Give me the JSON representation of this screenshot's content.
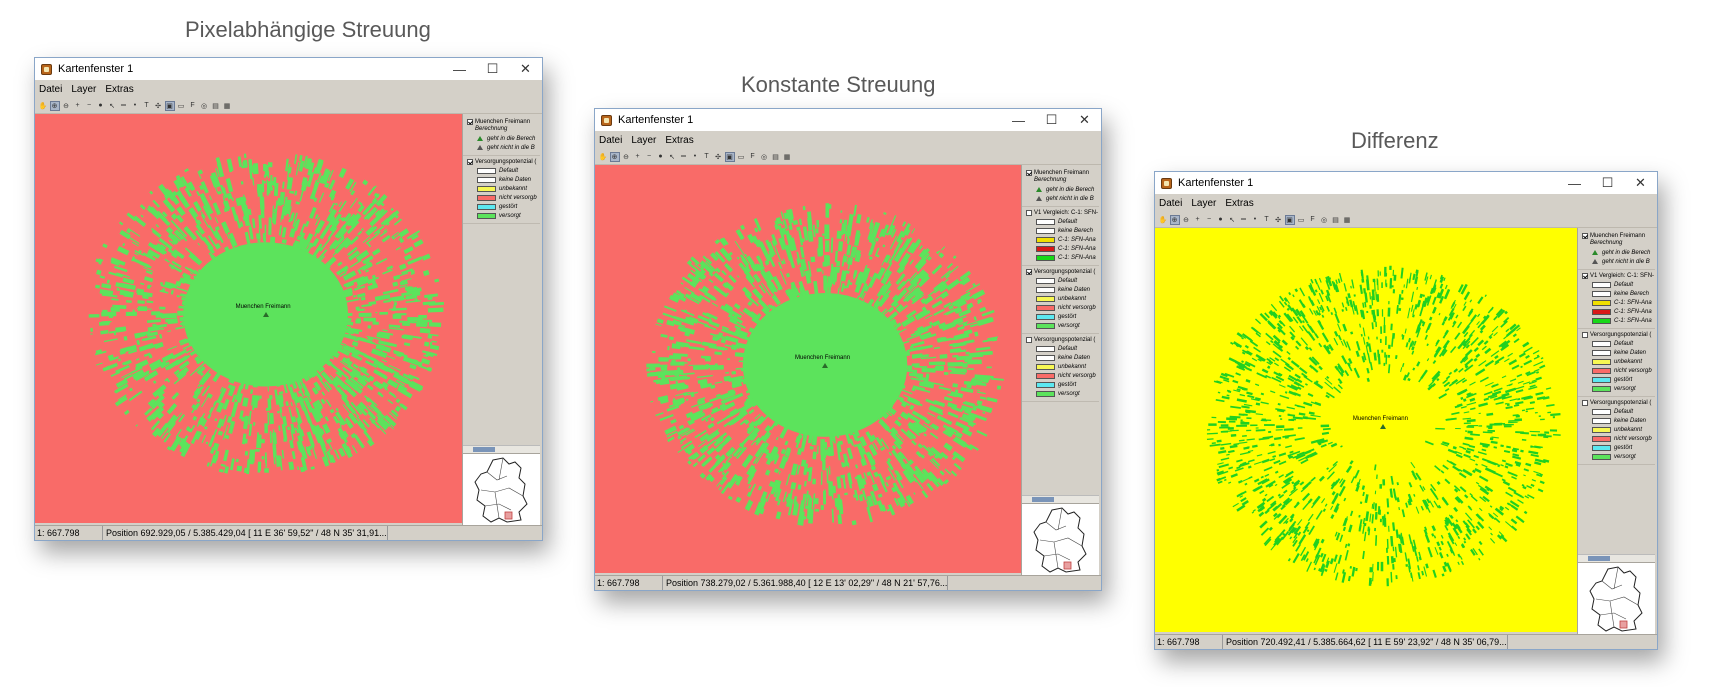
{
  "panels": [
    {
      "heading": "Pixelabhängige Streuung",
      "window": {
        "title": "Kartenfenster 1",
        "menu": [
          "Datei",
          "Layer",
          "Extras"
        ],
        "map": {
          "background": "#f96b68",
          "coverage_color": "#5ce35c",
          "site_label": "Muenchen Freimann"
        },
        "legend": [
          {
            "name": "Muenchen Freimann",
            "checked": true,
            "sublabel": "Berechnung",
            "items": [
              {
                "type": "tri-filled",
                "label": "geht in die Berech"
              },
              {
                "type": "tri-hollow",
                "label": "geht nicht in die B"
              }
            ]
          },
          {
            "name": "Versorgungspotenzial (",
            "checked": true,
            "sublabel": "",
            "items": [
              {
                "type": "swatch",
                "color": "#ffffff",
                "label": "Default"
              },
              {
                "type": "swatch",
                "color": "#ffffff",
                "label": "keine Daten"
              },
              {
                "type": "swatch",
                "color": "#f7f752",
                "label": "unbekannt"
              },
              {
                "type": "swatch",
                "color": "#f96b68",
                "label": "nicht versorgb"
              },
              {
                "type": "swatch",
                "color": "#5ce8f0",
                "label": "gestört"
              },
              {
                "type": "swatch",
                "color": "#5ce35c",
                "label": "versorgt"
              }
            ]
          }
        ],
        "status": {
          "scale": "1: 667.798",
          "position": "Position 692.929,05 / 5.385.429,04 [  11 E 36' 59,52\"  / 48 N 35' 31,91..."
        }
      }
    },
    {
      "heading": "Konstante Streuung",
      "window": {
        "title": "Kartenfenster 1",
        "menu": [
          "Datei",
          "Layer",
          "Extras"
        ],
        "map": {
          "background": "#f96b68",
          "coverage_color": "#5ce35c",
          "site_label": "Muenchen Freimann"
        },
        "legend": [
          {
            "name": "Muenchen Freimann",
            "checked": true,
            "sublabel": "Berechnung",
            "items": [
              {
                "type": "tri-filled",
                "label": "geht in die Berech"
              },
              {
                "type": "tri-hollow",
                "label": "geht nicht in die B"
              }
            ]
          },
          {
            "name": "V1 Vergleich: C-1: SFN-",
            "checked": false,
            "sublabel": "",
            "items": [
              {
                "type": "swatch",
                "color": "#ffffff",
                "label": "Default"
              },
              {
                "type": "swatch",
                "color": "#ffffff",
                "label": "keine Berech"
              },
              {
                "type": "swatch",
                "color": "#f0e000",
                "label": "C-1: SFN-Ana"
              },
              {
                "type": "swatch",
                "color": "#d81818",
                "label": "C-1: SFN-Ana"
              },
              {
                "type": "swatch",
                "color": "#18d818",
                "label": "C-1: SFN-Ana"
              }
            ]
          },
          {
            "name": "Versorgungspotenzial (",
            "checked": true,
            "sublabel": "",
            "items": [
              {
                "type": "swatch",
                "color": "#ffffff",
                "label": "Default"
              },
              {
                "type": "swatch",
                "color": "#ffffff",
                "label": "keine Daten"
              },
              {
                "type": "swatch",
                "color": "#f7f752",
                "label": "unbekannt"
              },
              {
                "type": "swatch",
                "color": "#f96b68",
                "label": "nicht versorgb"
              },
              {
                "type": "swatch",
                "color": "#5ce8f0",
                "label": "gestört"
              },
              {
                "type": "swatch",
                "color": "#5ce35c",
                "label": "versorgt"
              }
            ]
          },
          {
            "name": "Versorgungspotenzial (",
            "checked": false,
            "sublabel": "",
            "items": [
              {
                "type": "swatch",
                "color": "#ffffff",
                "label": "Default"
              },
              {
                "type": "swatch",
                "color": "#ffffff",
                "label": "keine Daten"
              },
              {
                "type": "swatch",
                "color": "#f7f752",
                "label": "unbekannt"
              },
              {
                "type": "swatch",
                "color": "#f96b68",
                "label": "nicht versorgb"
              },
              {
                "type": "swatch",
                "color": "#5ce8f0",
                "label": "gestört"
              },
              {
                "type": "swatch",
                "color": "#5ce35c",
                "label": "versorgt"
              }
            ]
          }
        ],
        "status": {
          "scale": "1: 667.798",
          "position": "Position 738.279,02 / 5.361.988,40 [  12 E 13' 02,29\"  / 48 N 21' 57,76..."
        }
      }
    },
    {
      "heading": "Differenz",
      "window": {
        "title": "Kartenfenster 1",
        "menu": [
          "Datei",
          "Layer",
          "Extras"
        ],
        "map": {
          "background": "#ffff00",
          "coverage_color": "#20d020",
          "site_label": "Muenchen Freimann"
        },
        "legend": [
          {
            "name": "Muenchen Freimann",
            "checked": true,
            "sublabel": "Berechnung",
            "items": [
              {
                "type": "tri-filled",
                "label": "geht in die Berech"
              },
              {
                "type": "tri-hollow",
                "label": "geht nicht in die B"
              }
            ]
          },
          {
            "name": "V1 Vergleich: C-1: SFN-",
            "checked": true,
            "sublabel": "",
            "items": [
              {
                "type": "swatch",
                "color": "#ffffff",
                "label": "Default"
              },
              {
                "type": "swatch",
                "color": "#ffffff",
                "label": "keine Berech"
              },
              {
                "type": "swatch",
                "color": "#f0e000",
                "label": "C-1: SFN-Ana"
              },
              {
                "type": "swatch",
                "color": "#d81818",
                "label": "C-1: SFN-Ana"
              },
              {
                "type": "swatch",
                "color": "#18d818",
                "label": "C-1: SFN-Ana"
              }
            ]
          },
          {
            "name": "Versorgungspotenzial (",
            "checked": false,
            "sublabel": "",
            "items": [
              {
                "type": "swatch",
                "color": "#ffffff",
                "label": "Default"
              },
              {
                "type": "swatch",
                "color": "#ffffff",
                "label": "keine Daten"
              },
              {
                "type": "swatch",
                "color": "#f7f752",
                "label": "unbekannt"
              },
              {
                "type": "swatch",
                "color": "#f96b68",
                "label": "nicht versorgb"
              },
              {
                "type": "swatch",
                "color": "#5ce8f0",
                "label": "gestört"
              },
              {
                "type": "swatch",
                "color": "#5ce35c",
                "label": "versorgt"
              }
            ]
          },
          {
            "name": "Versorgungspotenzial (",
            "checked": false,
            "sublabel": "",
            "items": [
              {
                "type": "swatch",
                "color": "#ffffff",
                "label": "Default"
              },
              {
                "type": "swatch",
                "color": "#ffffff",
                "label": "keine Daten"
              },
              {
                "type": "swatch",
                "color": "#f7f752",
                "label": "unbekannt"
              },
              {
                "type": "swatch",
                "color": "#f96b68",
                "label": "nicht versorgb"
              },
              {
                "type": "swatch",
                "color": "#5ce8f0",
                "label": "gestört"
              },
              {
                "type": "swatch",
                "color": "#5ce35c",
                "label": "versorgt"
              }
            ]
          }
        ],
        "status": {
          "scale": "1: 667.798",
          "position": "Position 720.492,41 / 5.385.664,62 [  11 E 59' 23,92\"  / 48 N 35' 06,79..."
        }
      }
    }
  ],
  "icons": [
    "hand-icon",
    "zoom-select-icon",
    "zoom-box-icon",
    "zoom-in-icon",
    "zoom-out-icon",
    "globe-icon",
    "select-icon",
    "measure-icon",
    "point-icon",
    "text-icon",
    "crosshair-icon",
    "layer-toggle-icon",
    "split-view-icon",
    "font-icon",
    "settings-icon",
    "export-icon",
    "grid-icon"
  ],
  "window_controls": {
    "minimize": "—",
    "maximize": "☐",
    "close": "✕"
  }
}
